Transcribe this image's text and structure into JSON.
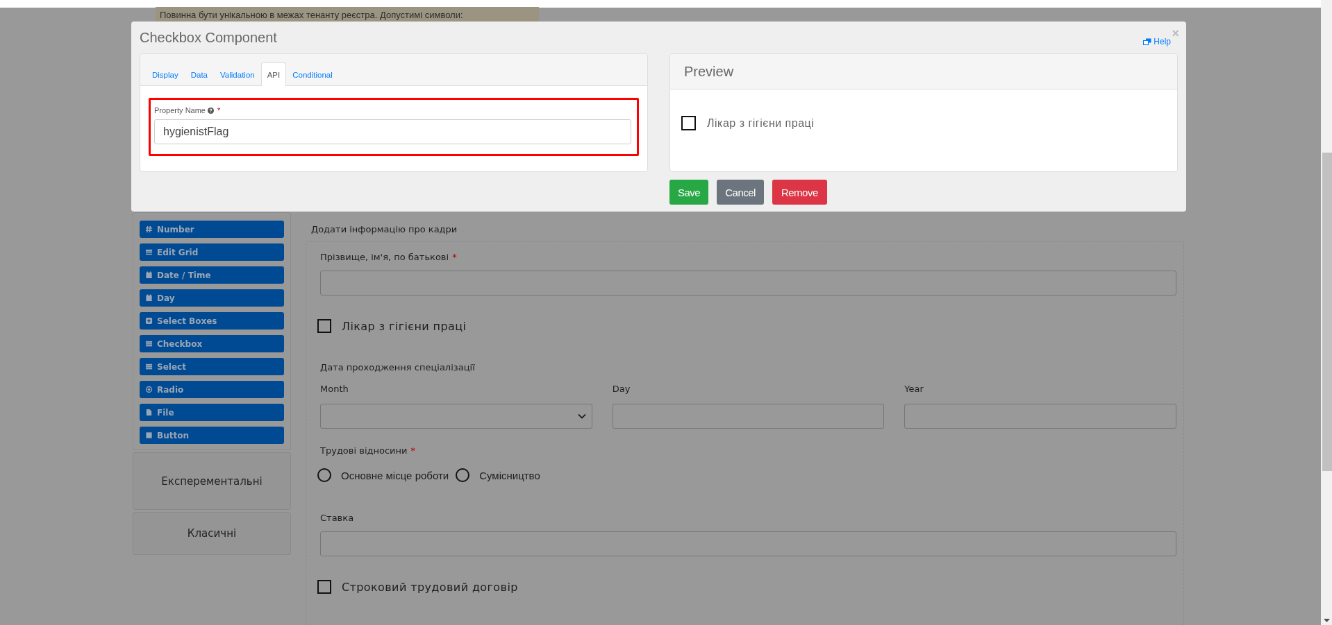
{
  "tooltip": {
    "text": "Повинна бути унікальною в межах тенанту реєстра. Допустимі символи:"
  },
  "sidebar": {
    "components": [
      {
        "label": "Number",
        "kind": "number"
      },
      {
        "label": "Edit Grid",
        "kind": "grid"
      },
      {
        "label": "Date / Time",
        "kind": "calendar"
      },
      {
        "label": "Day",
        "kind": "calendar"
      },
      {
        "label": "Select Boxes",
        "kind": "plus"
      },
      {
        "label": "Checkbox",
        "kind": "list"
      },
      {
        "label": "Select",
        "kind": "list"
      },
      {
        "label": "Radio",
        "kind": "radio"
      },
      {
        "label": "File",
        "kind": "file"
      },
      {
        "label": "Button",
        "kind": "square"
      }
    ],
    "groups": [
      {
        "label": "Експерементальні"
      },
      {
        "label": "Класичні"
      }
    ]
  },
  "form": {
    "title": "Додати інформацію про кадри",
    "fields": [
      {
        "kind": "text",
        "label": "Прізвище, ім'я, по батькові",
        "required_mark": "*"
      },
      {
        "kind": "checkbox",
        "label": "Лікар з гігієни праці",
        "checked": false
      },
      {
        "kind": "date",
        "label": "Дата проходження спеціалізації",
        "parts": [
          "Month",
          "Day",
          "Year"
        ]
      },
      {
        "kind": "radio",
        "label": "Трудові відносини",
        "required_mark": "*",
        "options": [
          {
            "label": "Основне місце роботи",
            "selected": false
          },
          {
            "label": "Сумісництво",
            "selected": false
          }
        ]
      },
      {
        "kind": "text",
        "label": "Ставка"
      },
      {
        "kind": "checkbox",
        "label": "Строковий трудовий договір",
        "checked": false
      }
    ]
  },
  "modal": {
    "title": "Checkbox Component",
    "help": "Help",
    "close": "×",
    "tabs": [
      {
        "label": "Display",
        "selected": false
      },
      {
        "label": "Data",
        "selected": false
      },
      {
        "label": "Validation",
        "selected": false
      },
      {
        "label": "API",
        "selected": true
      },
      {
        "label": "Conditional",
        "selected": false
      }
    ],
    "property": {
      "label": "Property Name",
      "required_mark": "*",
      "value": "hygienistFlag"
    },
    "preview": {
      "title": "Preview",
      "checkbox": {
        "label": "Лікар з гігієни праці",
        "checked": false
      }
    },
    "buttons": [
      {
        "label": "Save",
        "kind": "save"
      },
      {
        "label": "Cancel",
        "kind": "cancel"
      },
      {
        "label": "Remove",
        "kind": "remove"
      }
    ]
  }
}
